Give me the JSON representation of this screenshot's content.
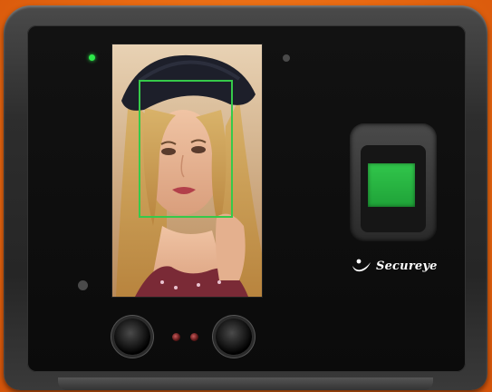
{
  "device": {
    "brand": "Secureye",
    "colors": {
      "background": "#e96a12",
      "body": "#2d2d2d",
      "face_panel": "#0f0f0f",
      "status_led": "#2de84a",
      "face_detect_box": "#36c94a",
      "fingerprint_pad": "#2bb844"
    },
    "icons": {
      "brand_logo": "secureye-swoosh-logo",
      "cameras": "camera-lens",
      "fingerprint": "fingerprint-sensor"
    }
  }
}
